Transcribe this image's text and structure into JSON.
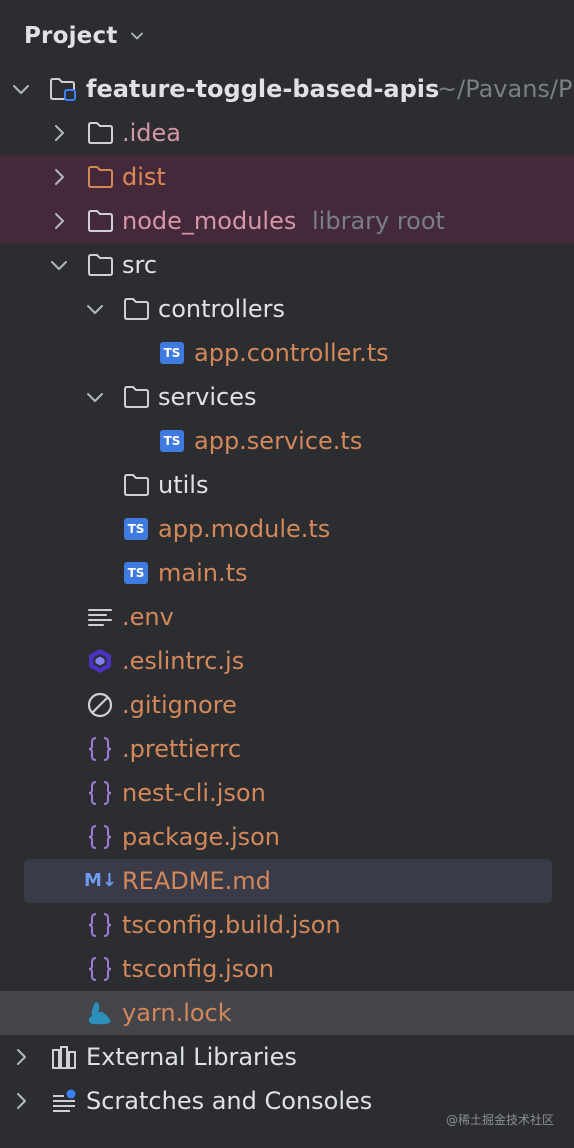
{
  "header": {
    "title": "Project"
  },
  "colors": {
    "background": "#2b2d30",
    "excluded_row": "#43293a",
    "selected_row": "#43454a",
    "hover_row": "#393b48",
    "folder_excluded": "#d4885a",
    "file_text": "#d4885a",
    "ts_badge": "#3f7ae0"
  },
  "tree": {
    "root": {
      "name": "feature-toggle-based-apis",
      "path_hint": "~/Pavans/P"
    },
    "idea": {
      "name": ".idea"
    },
    "dist": {
      "name": "dist"
    },
    "node_modules": {
      "name": "node_modules",
      "hint": "library root"
    },
    "src": {
      "name": "src"
    },
    "controllers": {
      "name": "controllers"
    },
    "app_controller": {
      "name": "app.controller.ts",
      "badge": "TS"
    },
    "services": {
      "name": "services"
    },
    "app_service": {
      "name": "app.service.ts",
      "badge": "TS"
    },
    "utils": {
      "name": "utils"
    },
    "app_module": {
      "name": "app.module.ts",
      "badge": "TS"
    },
    "main": {
      "name": "main.ts",
      "badge": "TS"
    },
    "env": {
      "name": ".env"
    },
    "eslintrc": {
      "name": ".eslintrc.js"
    },
    "gitignore": {
      "name": ".gitignore"
    },
    "prettierrc": {
      "name": ".prettierrc"
    },
    "nest_cli": {
      "name": "nest-cli.json"
    },
    "package": {
      "name": "package.json"
    },
    "readme": {
      "name": "README.md",
      "badge": "M↓"
    },
    "tsconfig_build": {
      "name": "tsconfig.build.json"
    },
    "tsconfig": {
      "name": "tsconfig.json"
    },
    "yarn_lock": {
      "name": "yarn.lock"
    },
    "external_libraries": {
      "name": "External Libraries"
    },
    "scratches": {
      "name": "Scratches and Consoles"
    }
  },
  "watermark": "@稀土掘金技术社区"
}
